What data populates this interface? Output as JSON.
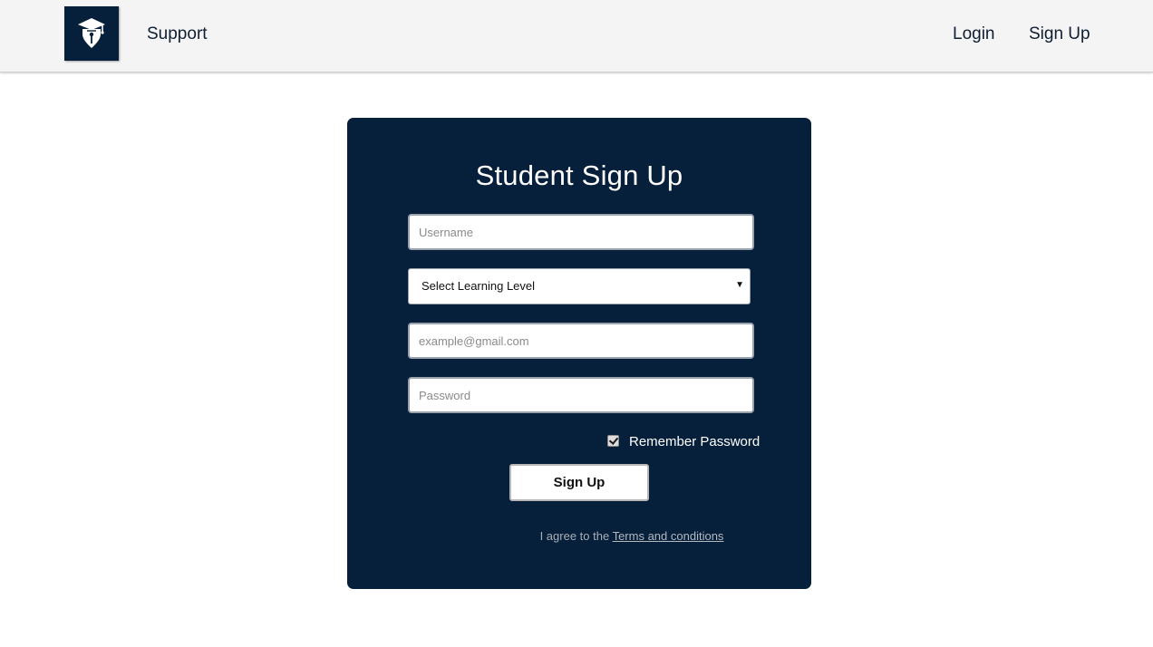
{
  "header": {
    "logo_icon": "graduation-cap-pen-icon",
    "support": "Support",
    "login": "Login",
    "signup": "Sign Up"
  },
  "form": {
    "title": "Student Sign Up",
    "username_placeholder": "Username",
    "level_select": "Select Learning Level",
    "email_placeholder": "example@gmail.com",
    "password_placeholder": "Password",
    "remember_label": "Remember Password",
    "remember_checked": true,
    "submit_label": "Sign Up",
    "terms_prefix": "I agree to the ",
    "terms_link": "Terms and conditions"
  },
  "colors": {
    "card_bg": "#061f3b",
    "navbar_bg": "#f4f4f4"
  }
}
